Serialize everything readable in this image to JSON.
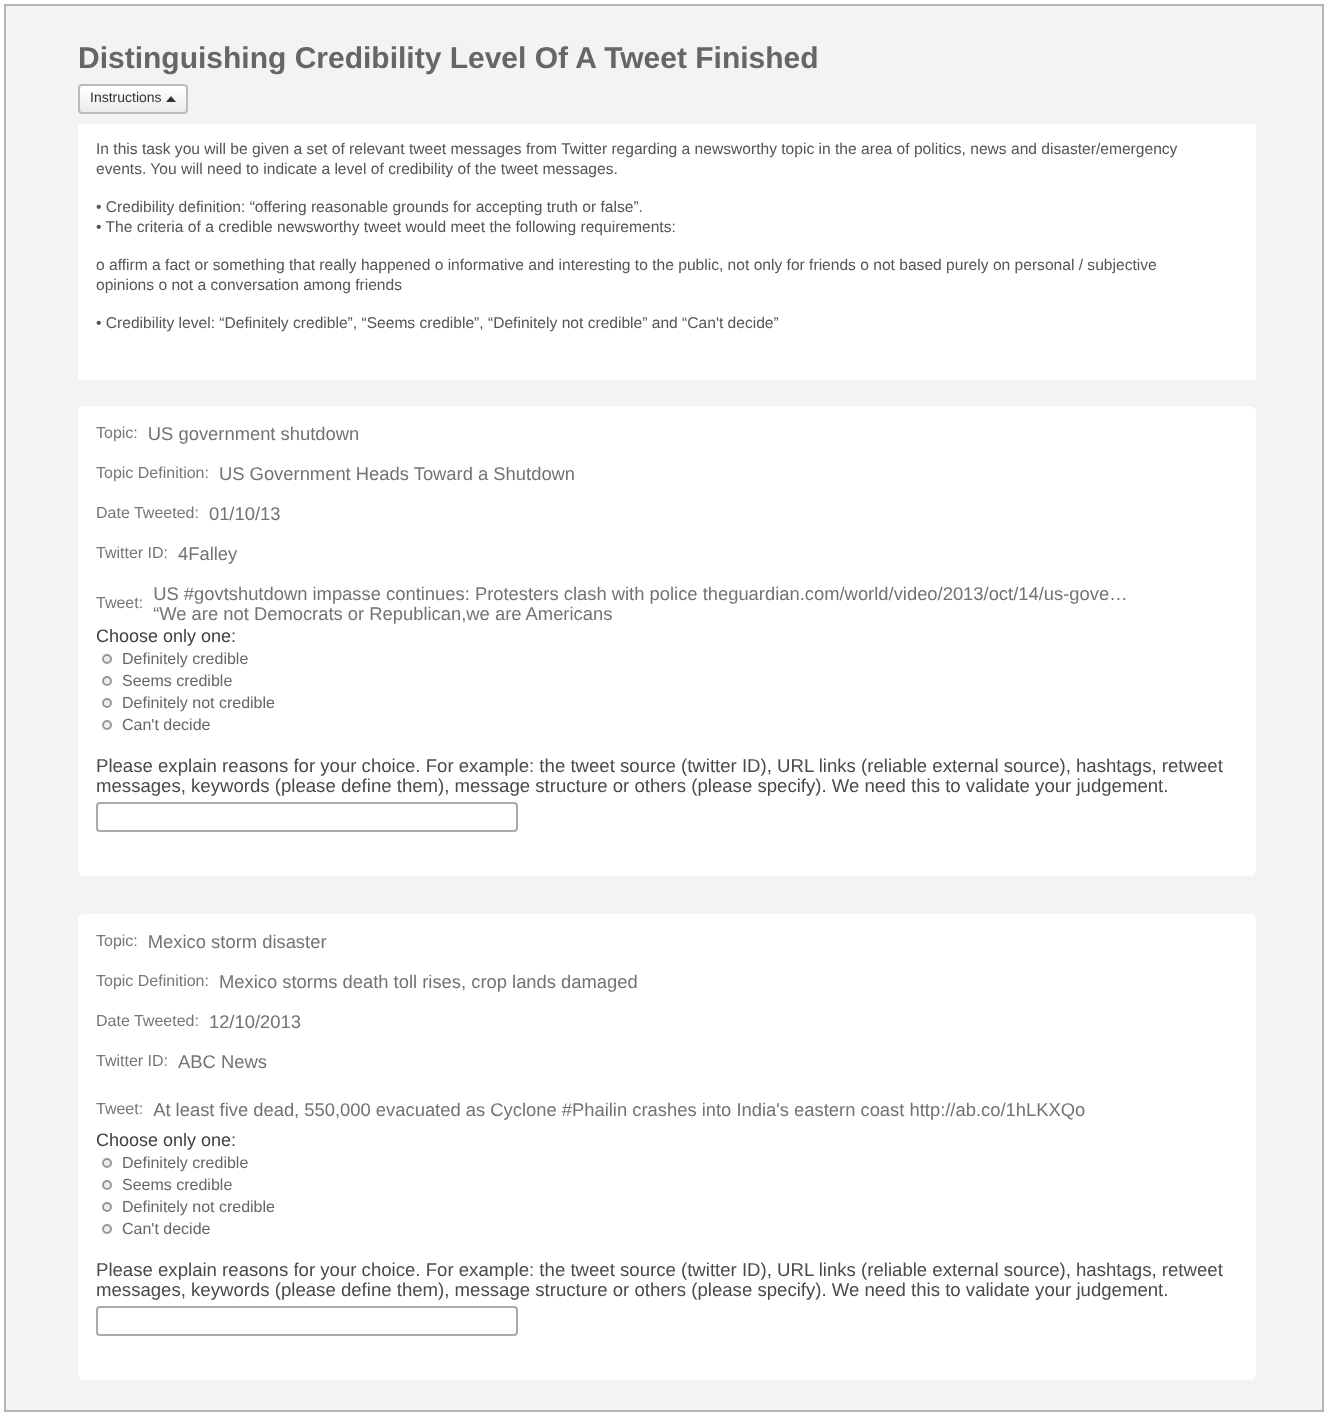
{
  "title": "Distinguishing Credibility Level Of A Tweet Finished",
  "instructions": {
    "label": "Instructions",
    "expanded": true,
    "blocks": [
      [
        "In this task you will be given a set of relevant tweet messages from Twitter regarding a newsworthy topic in the area of politics, news and disaster/emergency events. You will need to indicate a level of credibility of the tweet messages."
      ],
      [
        "• Credibility definition: “offering reasonable grounds for accepting truth or false”.",
        "• The criteria of a credible newsworthy tweet would meet the following requirements:"
      ],
      [
        "o affirm a fact or something that really happened o informative and interesting to the public, not only for friends o not based purely on personal / subjective opinions o not a conversation among friends"
      ],
      [
        "• Credibility level: “Definitely credible”, “Seems credible”, “Definitely not credible” and “Can't decide”"
      ]
    ]
  },
  "tweets": [
    {
      "fields": [
        {
          "label": "Topic:",
          "value": "US government shutdown"
        },
        {
          "label": "Topic Definition:",
          "value": "US Government Heads Toward a Shutdown"
        },
        {
          "label": "Date Tweeted:",
          "value": "01/10/13"
        },
        {
          "label": "Twitter ID:",
          "value": "4Falley"
        },
        {
          "label": "Tweet:",
          "value": "US #govtshutdown impasse continues: Protesters clash with police theguardian.com/world/video/2013/oct/14/us-gove…\n“We are not Democrats or Republican,we are Americans"
        }
      ],
      "prompt": "Choose only one:",
      "options": [
        {
          "label": "Definitely credible",
          "selected": false
        },
        {
          "label": "Seems credible",
          "selected": false
        },
        {
          "label": "Definitely not credible",
          "selected": false
        },
        {
          "label": "Can't decide",
          "selected": false
        }
      ],
      "explanation": "Please explain reasons for your choice. For example: the tweet source (twitter ID), URL links (reliable external source), hashtags, retweet messages, keywords (please define them), message structure or others (please specify). We need this to validate your judgement."
    },
    {
      "fields": [
        {
          "label": "Topic:",
          "value": "Mexico storm disaster"
        },
        {
          "label": "Topic Definition:",
          "value": "Mexico storms death toll rises, crop lands damaged"
        },
        {
          "label": "Date Tweeted:",
          "value": "12/10/2013"
        },
        {
          "label": "Twitter ID:",
          "value": "ABC News"
        },
        {
          "label": "Tweet:",
          "value": "At least five dead, 550,000 evacuated as Cyclone #Phailin crashes into India's eastern coast http://ab.co/1hLKXQo"
        }
      ],
      "prompt": "Choose only one:",
      "options": [
        {
          "label": "Definitely credible",
          "selected": false
        },
        {
          "label": "Seems credible",
          "selected": false
        },
        {
          "label": "Definitely not credible",
          "selected": false
        },
        {
          "label": "Can't decide",
          "selected": false
        }
      ],
      "explanation": "Please explain reasons for your choice. For example: the tweet source (twitter ID), URL links (reliable external source), hashtags, retweet messages, keywords (please define them), message structure or others (please specify). We need this to validate your judgement."
    }
  ]
}
